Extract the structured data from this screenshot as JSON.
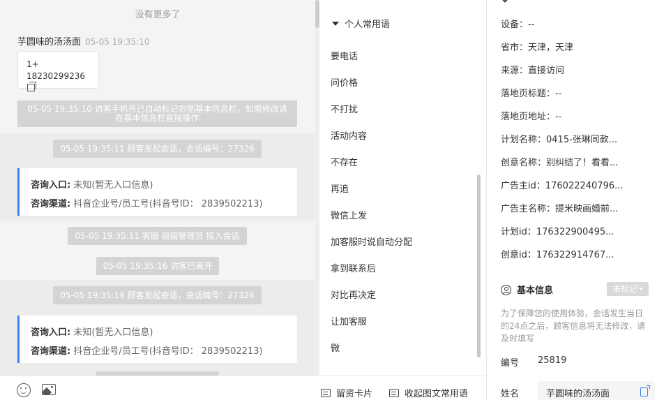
{
  "chat": {
    "no_more": "没有更多了",
    "message": {
      "sender": "芋圆味的汤汤面",
      "time": "05-05 19:35:10",
      "line1": "1+",
      "line2": "18230299236"
    },
    "system_notice": "05-05 19:35:10 访客手机号已自动标记右侧基本信息栏，如需修改请在基本信息栏直接操作",
    "events": [
      "05-05 19:35:11 顾客发起会话，会话编号：27326",
      "05-05 19:35:11 客服 超级管理员 接入会话",
      "05-05 19:35:16 访客已离开",
      "05-05 19:35:19 顾客发起会话，会话编号：27326"
    ],
    "entry_cards": [
      {
        "entry_label": "咨询入口:",
        "entry_value": "未知(暂无入口信息)",
        "channel_label": "咨询渠道:",
        "channel_value": "抖音企业号/员工号(抖音号ID： 2839502213)"
      },
      {
        "entry_label": "咨询入口:",
        "entry_value": "未知(暂无入口信息)",
        "channel_label": "咨询渠道:",
        "channel_value": "抖音企业号/员工号(抖音号ID： 2839502213)"
      }
    ]
  },
  "phrases": {
    "header": "个人常用语",
    "items": [
      "要电话",
      "问价格",
      "不打扰",
      "活动内容",
      "不存在",
      "再追",
      "微信上发",
      "加客服时说自动分配",
      "拿到联系后",
      "对比再决定",
      "让加客服",
      "微"
    ]
  },
  "info": {
    "rows": [
      "设备：--",
      "省市：天津，天津",
      "来源：直接访问",
      "落地页标题：--",
      "落地页地址：--",
      "计划名称：0415-张琳同款...",
      "创意名称：别纠结了！看看...",
      "广告主id：176022240796...",
      "广告主名称：提米映画婚前...",
      "计划id：176322900495...",
      "创意id：176322914767..."
    ],
    "basic_title": "基本信息",
    "tag_label": "未标记",
    "notice": "为了保障您的使用体验，会话发生当日的24点之后，顾客信息将无法修改，请及时填写",
    "number_label": "编号",
    "number_value": "25819",
    "name_label": "姓名",
    "name_value": "芋圆味的汤汤面"
  },
  "toolbar": {
    "card_label": "留资卡片",
    "collapse_label": "收起图文常用语"
  },
  "icons": [
    "emoji-icon",
    "image-icon",
    "copy-icon",
    "user-icon",
    "edit-icon",
    "card-icon"
  ],
  "colors": {
    "accent": "#3b7ff5",
    "system_bubble": "#d4d4d4"
  }
}
